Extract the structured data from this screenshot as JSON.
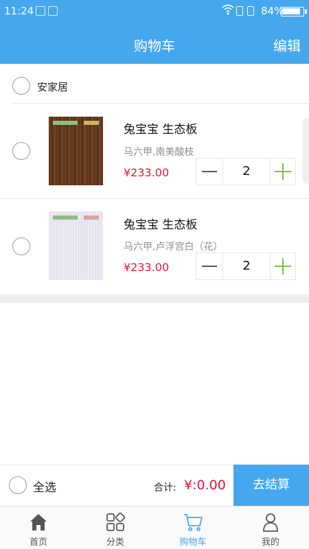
{
  "status_bar": {
    "time": "11:24",
    "battery": "84%",
    "icons": [
      "notification-icon",
      "usb-icon",
      "wifi-icon",
      "sim1-icon",
      "sim2-icon",
      "battery-icon"
    ]
  },
  "header": {
    "title": "购物车",
    "edit_label": "编辑"
  },
  "cart": {
    "store_name": "安家居",
    "items": [
      {
        "name": "兔宝宝 生态板",
        "spec": "马六甲,南美酸枝",
        "price": "¥233.00",
        "quantity": "2",
        "thumb_style": "wood"
      },
      {
        "name": "兔宝宝 生态板",
        "spec": "马六甲,卢浮宫白（花）",
        "price": "¥233.00",
        "quantity": "2",
        "thumb_style": "white"
      }
    ]
  },
  "checkout": {
    "select_all_label": "全选",
    "total_label": "合计:",
    "total_value": "¥:0.00",
    "pay_label": "去结算"
  },
  "tabs": [
    {
      "label": "首页",
      "icon": "home-icon",
      "active": false
    },
    {
      "label": "分类",
      "icon": "category-icon",
      "active": false
    },
    {
      "label": "购物车",
      "icon": "cart-icon",
      "active": true
    },
    {
      "label": "我的",
      "icon": "user-icon",
      "active": false
    }
  ],
  "colors": {
    "accent": "#45a7ee",
    "price": "#e0173c",
    "plus": "#76c043"
  }
}
